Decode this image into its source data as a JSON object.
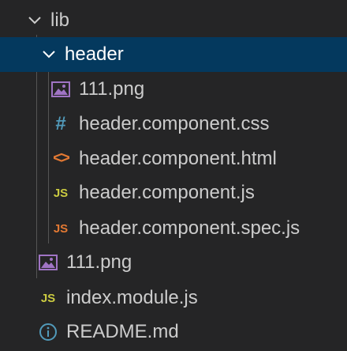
{
  "explorer": {
    "items": [
      {
        "label": "lib",
        "kind": "folder",
        "expanded": true
      },
      {
        "label": "header",
        "kind": "folder",
        "expanded": true,
        "selected": true
      },
      {
        "label": "111.png",
        "kind": "file",
        "icon": "image-icon"
      },
      {
        "label": "header.component.css",
        "kind": "file",
        "icon": "css-hash-icon"
      },
      {
        "label": "header.component.html",
        "kind": "file",
        "icon": "html-brackets-icon",
        "icon_glyph": "<>"
      },
      {
        "label": "header.component.js",
        "kind": "file",
        "icon": "javascript-icon",
        "icon_glyph": "JS"
      },
      {
        "label": "header.component.spec.js",
        "kind": "file",
        "icon": "javascript-spec-icon",
        "icon_glyph": "JS"
      },
      {
        "label": "111.png",
        "kind": "file",
        "icon": "image-icon"
      },
      {
        "label": "index.module.js",
        "kind": "file",
        "icon": "javascript-icon",
        "icon_glyph": "JS"
      },
      {
        "label": "README.md",
        "kind": "file",
        "icon": "info-icon"
      }
    ]
  },
  "colors": {
    "background": "#252526",
    "selection": "#04395e",
    "text": "#cccccc",
    "image_icon": "#a074c4",
    "css_icon": "#519aba",
    "html_icon": "#e37933",
    "js_icon": "#cbcb41",
    "spec_icon": "#e37933",
    "info_icon": "#519aba"
  }
}
